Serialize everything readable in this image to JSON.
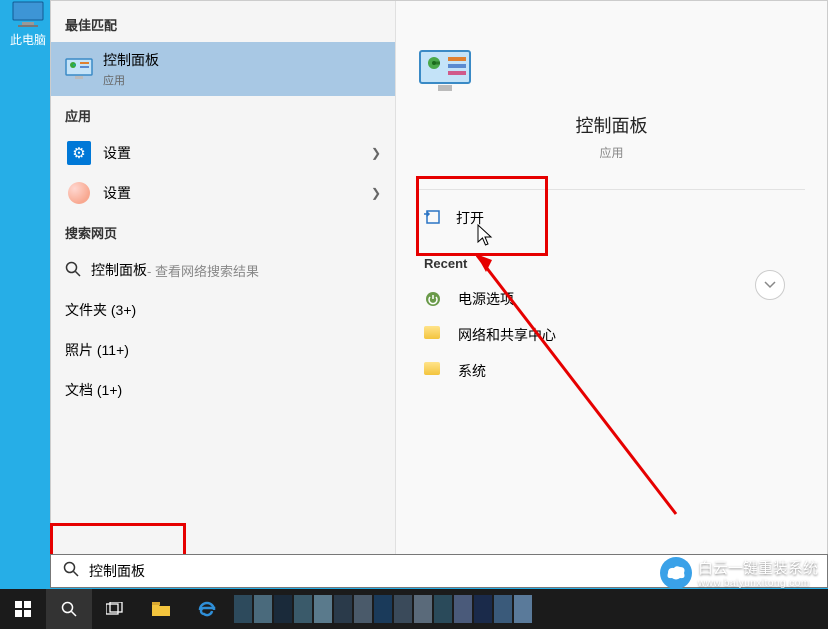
{
  "desktop": {
    "this_pc": "此电脑"
  },
  "left": {
    "best_match": "最佳匹配",
    "selected": {
      "title": "控制面板",
      "subtitle": "应用"
    },
    "apps_label": "应用",
    "apps": [
      {
        "title": "设置"
      },
      {
        "title": "设置"
      }
    ],
    "web_label": "搜索网页",
    "web": {
      "term": "控制面板",
      "suffix": " - 查看网络搜索结果"
    },
    "folders": "文件夹 (3+)",
    "photos": "照片 (11+)",
    "docs": "文档 (1+)"
  },
  "right": {
    "title": "控制面板",
    "subtitle": "应用",
    "open": "打开",
    "recent_label": "Recent",
    "recent": [
      {
        "label": "电源选项",
        "icon": "power"
      },
      {
        "label": "网络和共享中心",
        "icon": "folder"
      },
      {
        "label": "系统",
        "icon": "folder"
      }
    ]
  },
  "search": {
    "value": "控制面板"
  },
  "watermark": {
    "brand": "白云一键重装系统",
    "url": "www.baiyunxitong.com"
  }
}
